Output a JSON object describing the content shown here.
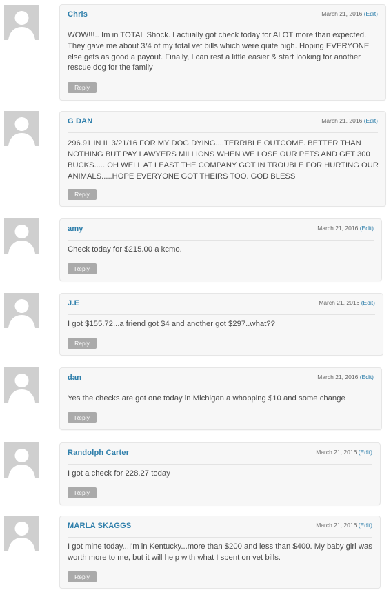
{
  "comments": [
    {
      "author": "Chris",
      "date": "March 21, 2016",
      "edit": "(Edit)",
      "text": "WOW!!!.. Im in TOTAL Shock. I actually got check today for ALOT more than expected. They gave me about 3/4 of my total vet bills which were quite high. Hoping EVERYONE else gets as good a payout. Finally, I can rest a little easier & start looking for another rescue dog for the family",
      "reply": "Reply"
    },
    {
      "author": "G DAN",
      "date": "March 21, 2016",
      "edit": "(Edit)",
      "text": "296.91 IN IL 3/21/16 FOR MY DOG DYING....TERRIBLE OUTCOME. BETTER THAN NOTHING BUT PAY LAWYERS MILLIONS WHEN WE LOSE OUR PETS AND GET 300 BUCKS..... OH WELL AT LEAST THE COMPANY GOT IN TROUBLE FOR HURTING OUR ANIMALS.....HOPE EVERYONE GOT THEIRS TOO. GOD BLESS",
      "reply": "Reply"
    },
    {
      "author": "amy",
      "date": "March 21, 2016",
      "edit": "(Edit)",
      "text": "Check today for $215.00 a kcmo.",
      "reply": "Reply"
    },
    {
      "author": "J.E",
      "date": "March 21, 2016",
      "edit": "(Edit)",
      "text": "I got $155.72...a friend got $4 and another got $297..what??",
      "reply": "Reply"
    },
    {
      "author": "dan",
      "date": "March 21, 2016",
      "edit": "(Edit)",
      "text": "Yes the checks are got one today in Michigan a whopping $10 and some change",
      "reply": "Reply"
    },
    {
      "author": "Randolph Carter",
      "date": "March 21, 2016",
      "edit": "(Edit)",
      "text": "I got a check for 228.27 today",
      "reply": "Reply"
    },
    {
      "author": "MARLA SKAGGS",
      "date": "March 21, 2016",
      "edit": "(Edit)",
      "text": "I got mine today...I'm in Kentucky...more than $200 and less than $400. My baby girl was worth more to me, but it will help with what I spent on vet bills.",
      "reply": "Reply"
    }
  ]
}
